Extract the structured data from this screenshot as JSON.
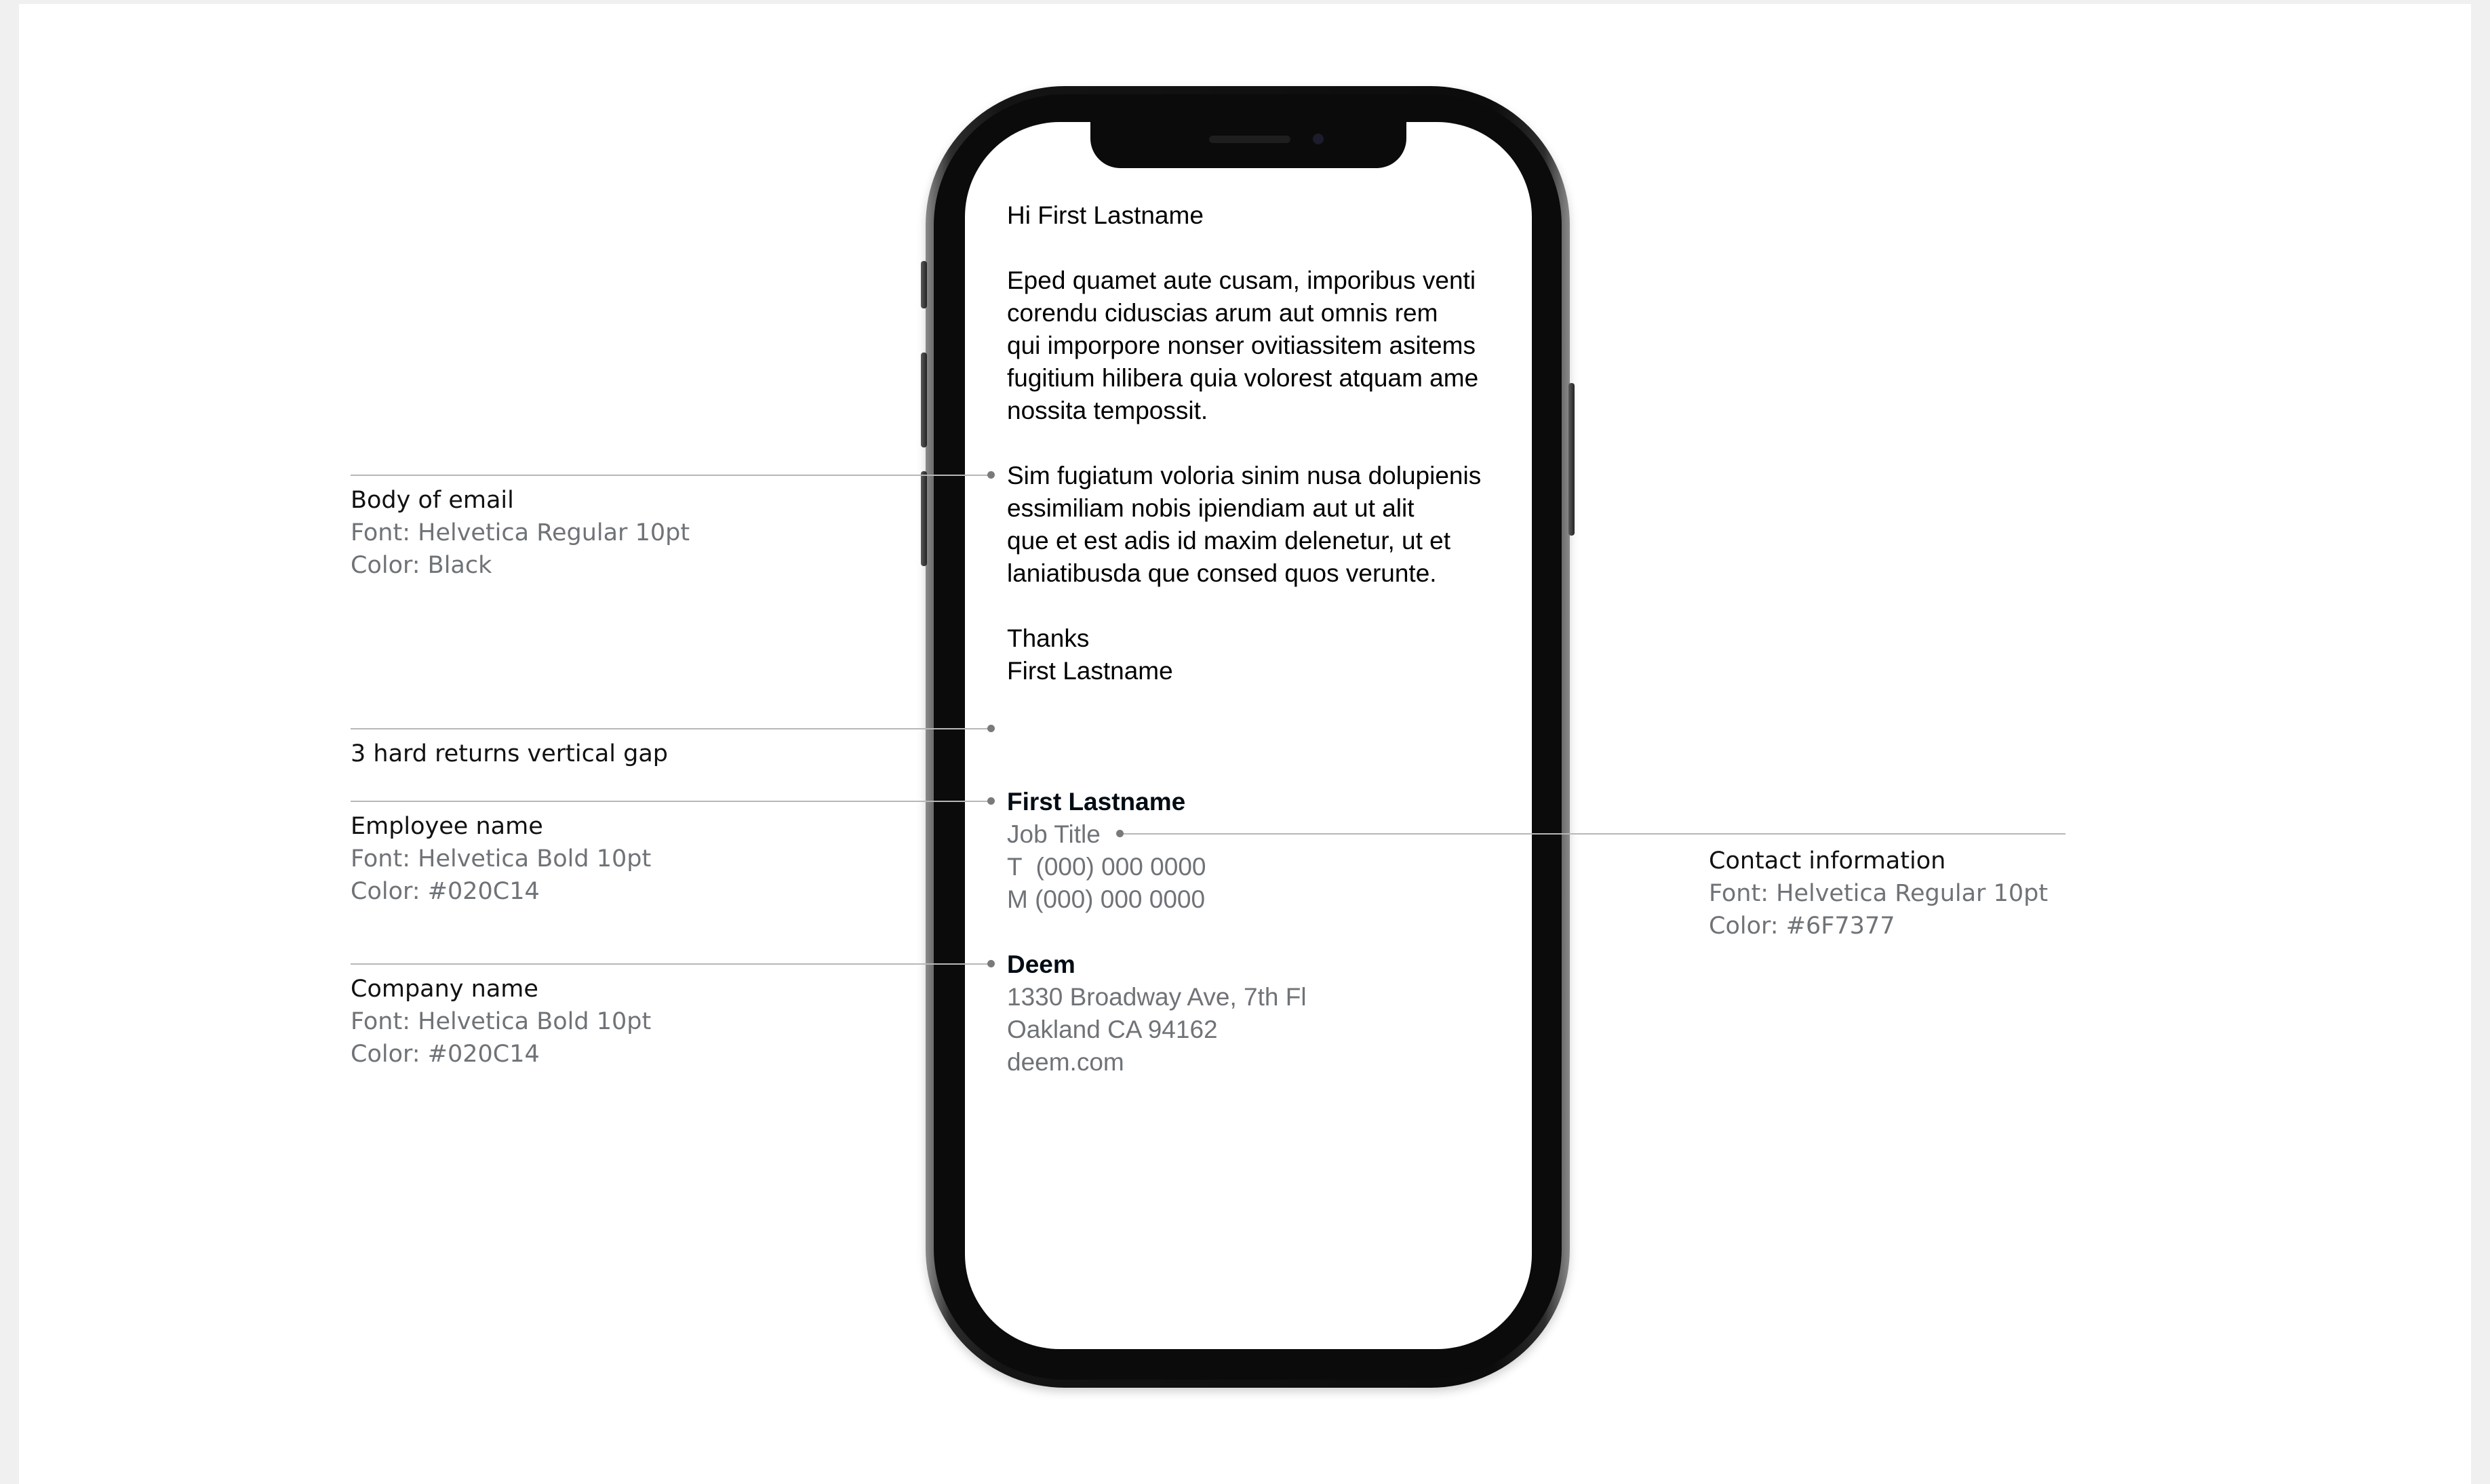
{
  "email": {
    "greeting": "Hi First Lastname",
    "paragraph1": [
      "Eped quamet aute cusam, imporibus venti",
      "corendu ciduscias arum aut omnis rem",
      "qui imporpore nonser ovitiassitem asitems",
      "fugitium hilibera quia volorest atquam ame",
      "nossita tempossit."
    ],
    "paragraph2": [
      "Sim fugiatum voloria sinim nusa dolupienis",
      "essimiliam nobis ipiendiam aut ut alit",
      "que et est adis id maxim delenetur, ut et",
      "laniatibusda que consed quos verunte."
    ],
    "closing": "Thanks",
    "closing_name": "First Lastname"
  },
  "signature": {
    "name": "First Lastname",
    "job_title": "Job Title",
    "phone": "T  (000) 000 0000",
    "mobile": "M (000) 000 0000",
    "company": "Deem",
    "address_line1": "1330 Broadway Ave, 7th Fl",
    "address_line2": "Oakland CA 94162",
    "website": "deem.com"
  },
  "annotations": {
    "body": {
      "title": "Body of email",
      "font": "Font: Helvetica Regular 10pt",
      "color": "Color: Black"
    },
    "gap": {
      "title": "3 hard returns vertical gap"
    },
    "employee": {
      "title": "Employee name",
      "font": "Font: Helvetica Bold 10pt",
      "color": "Color: #020C14"
    },
    "company": {
      "title": "Company name",
      "font": "Font: Helvetica Bold 10pt",
      "color": "Color: #020C14"
    },
    "contact": {
      "title": "Contact information",
      "font": "Font: Helvetica Regular 10pt",
      "color": "Color: #6F7377"
    }
  },
  "colors": {
    "body_text": "#000000",
    "name_text": "#020C14",
    "contact_text": "#6F7377",
    "leader_line": "#B7B7B7"
  }
}
